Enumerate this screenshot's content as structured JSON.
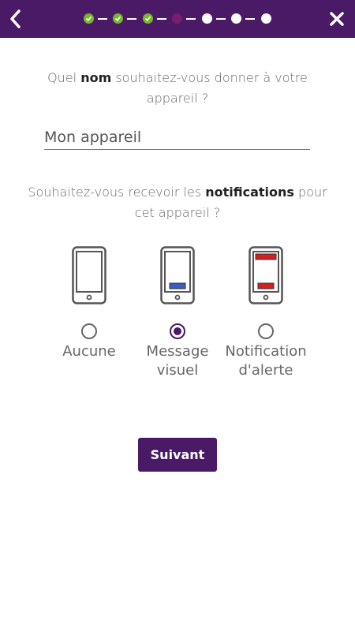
{
  "header": {
    "back_icon": "chevron-left-icon",
    "close_icon": "close-icon",
    "background": "#4a1a66",
    "steps": [
      "done",
      "done",
      "done",
      "current",
      "todo",
      "todo",
      "todo"
    ]
  },
  "name_section": {
    "question_prefix": "Quel ",
    "question_bold": "nom",
    "question_suffix": " souhaitez-vous donner à votre appareil ?",
    "input_placeholder": "Mon appareil"
  },
  "notification_section": {
    "question_prefix": "Souhaitez-vous recevoir les ",
    "question_bold": "notifications",
    "question_suffix": " pour cet appareil ?",
    "options": [
      {
        "line1": "Aucune",
        "line2": "",
        "selected": false
      },
      {
        "line1": "Message",
        "line2": "visuel",
        "selected": true
      },
      {
        "line1": "Notification",
        "line2": "d'alerte",
        "selected": false
      }
    ]
  },
  "next_button": {
    "label": "Suivant"
  },
  "colors": {
    "accent": "#4a1a66",
    "done": "#77b82a",
    "current": "#7a1d6e",
    "visual_bar": "#3a5bbf",
    "alert_bar": "#d21f1f"
  }
}
